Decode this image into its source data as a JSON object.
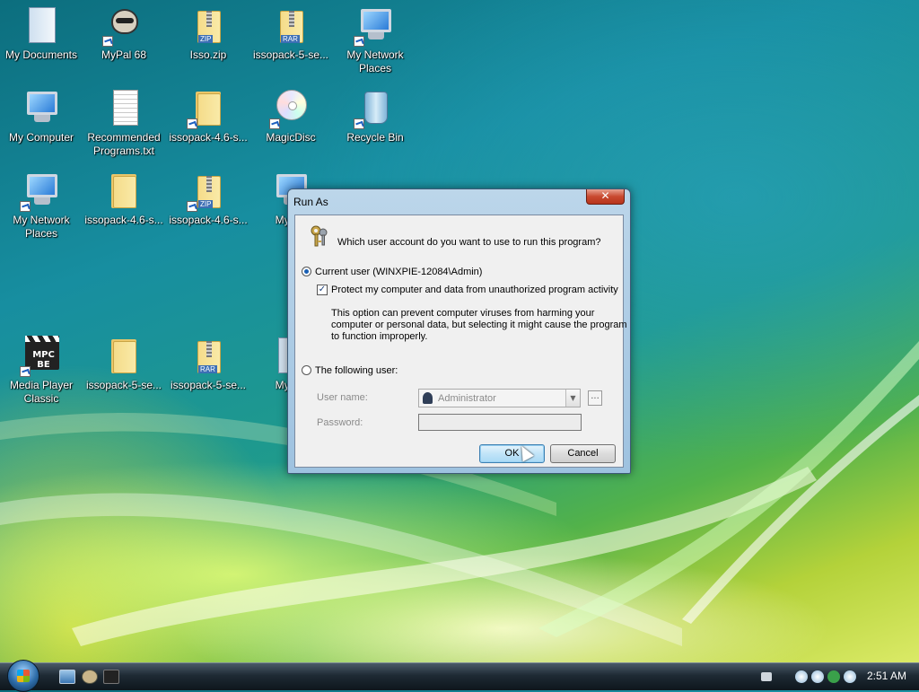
{
  "desktop": {
    "icons": [
      {
        "label": "My Documents"
      },
      {
        "label": "MyPal 68"
      },
      {
        "label": "Isso.zip",
        "tag": "ZIP"
      },
      {
        "label": "issopack-5-se...",
        "tag": "RAR"
      },
      {
        "label": "My Network\nPlaces"
      },
      {
        "label": "My Computer"
      },
      {
        "label": "Recommended\nPrograms.txt"
      },
      {
        "label": "issopack-4.6-s..."
      },
      {
        "label": "MagicDisc"
      },
      {
        "label": "Recycle Bin"
      },
      {
        "label": "My Network\nPlaces"
      },
      {
        "label": "issopack-4.6-s..."
      },
      {
        "label": "issopack-4.6-s...",
        "tag": "ZIP"
      },
      {
        "label": "My Co"
      },
      {
        "label": "Media Player\nClassic",
        "logo": "MPC BE"
      },
      {
        "label": "issopack-5-se..."
      },
      {
        "label": "issopack-5-se...",
        "tag": "RAR"
      },
      {
        "label": "My Do"
      }
    ]
  },
  "dialog": {
    "title": "Run As",
    "close_label": "✕",
    "question": "Which user account do you want to use to run this program?",
    "current_user_label": "Current user (WINXPIE-12084\\Admin)",
    "current_user_selected": true,
    "protect_label": "Protect my computer and data from unauthorized program activity",
    "protect_checked": true,
    "protect_description": "This option can prevent computer viruses from harming your\ncomputer or personal data, but selecting it might cause the program\nto function improperly.",
    "following_user_label": "The following user:",
    "username_label": "User name:",
    "username_value": "Administrator",
    "browse_label": "...",
    "password_label": "Password:",
    "ok_label": "OK",
    "cancel_label": "Cancel"
  },
  "taskbar": {
    "clock": "2:51 AM"
  }
}
